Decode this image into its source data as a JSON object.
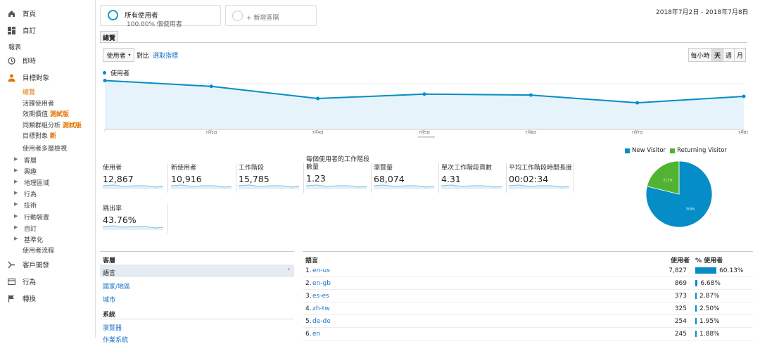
{
  "sidebar": {
    "home": "首頁",
    "custom": "自訂",
    "reports_header": "報表",
    "realtime": "即時",
    "audience": "目標對象",
    "audience_items": [
      {
        "label": "總覽",
        "badge": ""
      },
      {
        "label": "活躍使用者",
        "badge": ""
      },
      {
        "label": "效期價值",
        "badge": "測試版"
      },
      {
        "label": "同類群組分析",
        "badge": "測試版"
      },
      {
        "label": "目標對象",
        "badge": "新"
      },
      {
        "label": "使用者多層檢視",
        "badge": ""
      }
    ],
    "audience_groups": [
      "客層",
      "興趣",
      "地理區域",
      "行為",
      "技術",
      "行動裝置",
      "自訂",
      "基準化"
    ],
    "user_flow": "使用者流程",
    "acquisition": "客戶開發",
    "behavior": "行為",
    "conversions": "轉換"
  },
  "segments": {
    "all_users": "所有使用者",
    "all_users_sub": "100.00% 個使用者",
    "add_segment": "+ 新增區隔"
  },
  "date_range": "2018年7月2日 - 2018年7月8日",
  "tab_overview": "總覽",
  "controls": {
    "metric_select": "使用者",
    "vs": "對比",
    "select_metric": "選取指標",
    "granularity": [
      "每小時",
      "天",
      "週",
      "月"
    ],
    "selected_granularity": "天"
  },
  "chart_data": {
    "type": "line",
    "series": [
      {
        "name": "使用者",
        "values": [
          2880,
          2530,
          1790,
          2060,
          2000,
          1530,
          1920
        ]
      }
    ],
    "x": [
      "",
      "7月3日",
      "7月4日",
      "7月5日",
      "7月6日",
      "7月7日",
      "7月8日"
    ],
    "ylim": [
      0,
      3000
    ],
    "y_ticks": [
      "3,000",
      "1,500"
    ],
    "color": "#058dc7"
  },
  "metrics": [
    {
      "label": "使用者",
      "value": "12,867"
    },
    {
      "label": "新使用者",
      "value": "10,916"
    },
    {
      "label": "工作階段",
      "value": "15,785"
    },
    {
      "label": "每個使用者的工作階段數量",
      "value": "1.23"
    },
    {
      "label": "瀏覽量",
      "value": "68,074"
    },
    {
      "label": "單次工作階段頁數",
      "value": "4.31"
    },
    {
      "label": "平均工作階段時間長度",
      "value": "00:02:34"
    },
    {
      "label": "跳出率",
      "value": "43.76%"
    }
  ],
  "pie_data": {
    "legend": [
      "New Visitor",
      "Returning Visitor"
    ],
    "values": [
      78.8,
      21.2
    ],
    "labels": [
      "78.8%",
      "21.2%"
    ],
    "colors": [
      "#058dc7",
      "#50b432"
    ]
  },
  "demographics": {
    "title": "客層",
    "items": [
      "語言",
      "國家/地區",
      "城市"
    ],
    "system_title": "系統",
    "system_items": [
      "瀏覽器",
      "作業系統"
    ]
  },
  "lang_table": {
    "col_language": "語言",
    "col_users": "使用者",
    "col_pct": "% 使用者",
    "rows": [
      {
        "rank": "1.",
        "lang": "en-us",
        "users": "7,827",
        "pct": "60.13%",
        "frac": 0.6013
      },
      {
        "rank": "2.",
        "lang": "en-gb",
        "users": "869",
        "pct": "6.68%",
        "frac": 0.0668
      },
      {
        "rank": "3.",
        "lang": "es-es",
        "users": "373",
        "pct": "2.87%",
        "frac": 0.0287
      },
      {
        "rank": "4.",
        "lang": "zh-tw",
        "users": "325",
        "pct": "2.50%",
        "frac": 0.025
      },
      {
        "rank": "5.",
        "lang": "de-de",
        "users": "254",
        "pct": "1.95%",
        "frac": 0.0195
      },
      {
        "rank": "6.",
        "lang": "en",
        "users": "245",
        "pct": "1.88%",
        "frac": 0.0188
      }
    ]
  }
}
